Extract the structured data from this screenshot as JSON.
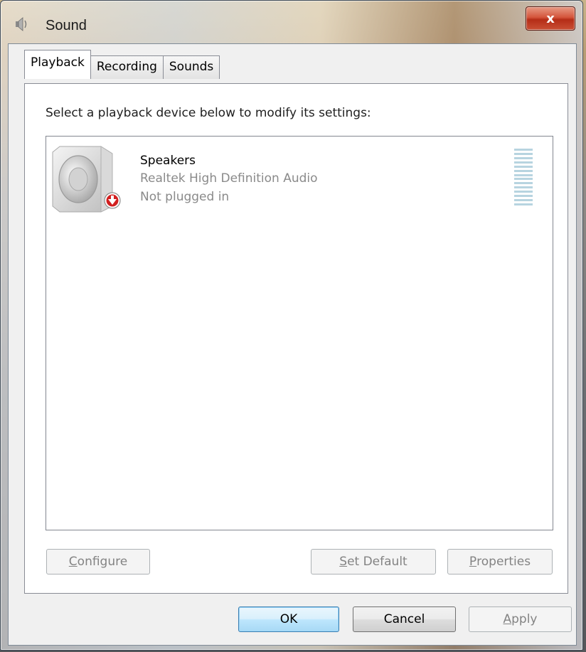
{
  "window": {
    "title": "Sound",
    "close_label": "x"
  },
  "tabs": [
    {
      "label": "Playback"
    },
    {
      "label": "Recording"
    },
    {
      "label": "Sounds"
    }
  ],
  "playback": {
    "instruction": "Select a playback device below to modify its settings:",
    "devices": [
      {
        "name": "Speakers",
        "driver": "Realtek High Definition Audio",
        "status": "Not plugged in",
        "icon": "speaker-icon",
        "status_icon": "red-down-arrow-icon"
      }
    ],
    "buttons": {
      "configure": {
        "pre": "",
        "u": "C",
        "post": "onfigure"
      },
      "set_default": {
        "pre": "",
        "u": "S",
        "post": "et Default"
      },
      "properties": {
        "pre": "",
        "u": "P",
        "post": "roperties"
      }
    }
  },
  "dialog_buttons": {
    "ok": "OK",
    "cancel": "Cancel",
    "apply": {
      "pre": "",
      "u": "A",
      "post": "pply"
    }
  },
  "colors": {
    "accent": "#3c7fb1",
    "close": "#c94f34",
    "disabled_text": "#838383",
    "level_meter": "#b7d4e0"
  }
}
